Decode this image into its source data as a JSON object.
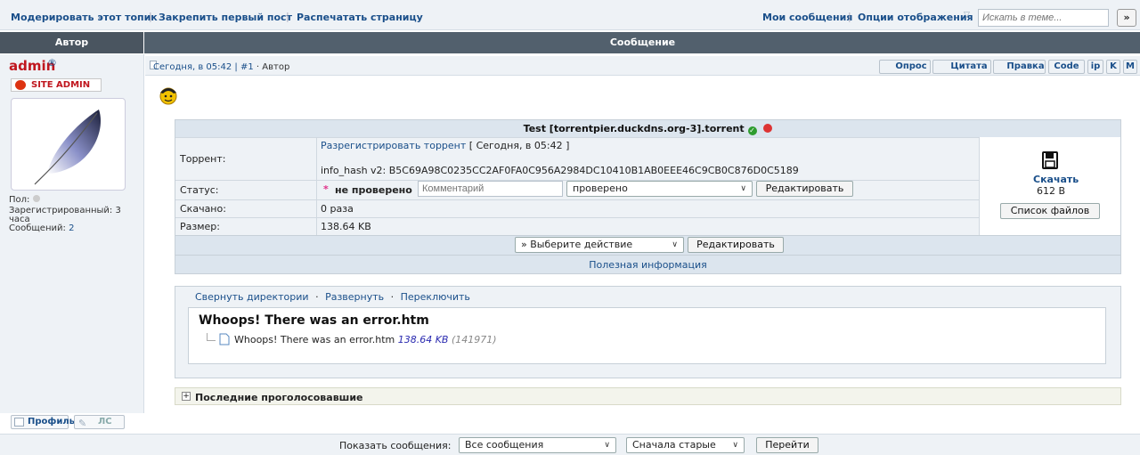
{
  "topbar": {
    "moderate": "Модерировать этот топик",
    "pin": "Закрепить первый пост",
    "print": "Распечатать страницу",
    "my_posts": "Мои сообщения",
    "display_options": "Опции отображения",
    "search_placeholder": "Искать в теме...",
    "search_go": "»"
  },
  "header": {
    "author": "Автор",
    "message": "Сообщение"
  },
  "author": {
    "name": "admin",
    "name_mark": "®",
    "rank": "SITE ADMIN",
    "gender_label": "Пол:",
    "registered": "Зарегистрированный: 3",
    "registered_2": "часа",
    "posts_label": "Сообщений:",
    "posts_count": "2",
    "profile_btn": "Профиль",
    "pm_btn": "ЛС"
  },
  "post": {
    "date": "Сегодня, в 05:42",
    "num": "#1",
    "author_tag": "· Автор",
    "buttons": {
      "poll": "Опрос",
      "quote": "Цитата",
      "edit": "Правка",
      "code": "Code",
      "ip": "ip",
      "k": "K",
      "m": "M"
    }
  },
  "torrent": {
    "title": "Test [torrentpier.duckdns.org-3].torrent",
    "torrent_label": "Торрент:",
    "unregister_link": "Разрегистрировать торрент",
    "unregister_date": "[ Сегодня, в 05:42 ]",
    "info_hash": "info_hash v2: B5C69A98C0235CC2AF0FA0C956A2984DC10410B1AB0EEE46C9CB0C876D0C5189",
    "status_label": "Статус:",
    "status_star": "*",
    "status_value": "не проверено",
    "comment_placeholder": "Комментарий",
    "status_select": "проверено",
    "edit_btn": "Редактировать",
    "downloaded_label": "Скачано:",
    "downloaded_value": "0 раза",
    "size_label": "Размер:",
    "size_value": "138.64 KB",
    "download_link": "Скачать",
    "download_size": "612 B",
    "file_list_btn": "Список файлов",
    "action_select": "» Выберите действие",
    "action_btn": "Редактировать",
    "useful_info": "Полезная информация"
  },
  "filelist": {
    "collapse": "Свернуть директории",
    "expand": "Развернуть",
    "toggle": "Переключить",
    "dot": "·",
    "folder": "Whoops! There was an error.htm",
    "file_name": "Whoops! There was an error.htm",
    "file_size": "138.64 KB",
    "file_bytes": "(141971)"
  },
  "voted": {
    "label": "Последние проголосовавшие",
    "toggle": "+"
  },
  "bottom": {
    "show_label": "Показать сообщения:",
    "show_select": "Все сообщения",
    "order_select": "Сначала старые",
    "go_btn": "Перейти"
  },
  "colors": {
    "accent": "#1a4f8a",
    "header": "#52606d",
    "admin": "#c0161e",
    "row_bg": "#eef2f6",
    "green_check": "#2e9c2e"
  }
}
